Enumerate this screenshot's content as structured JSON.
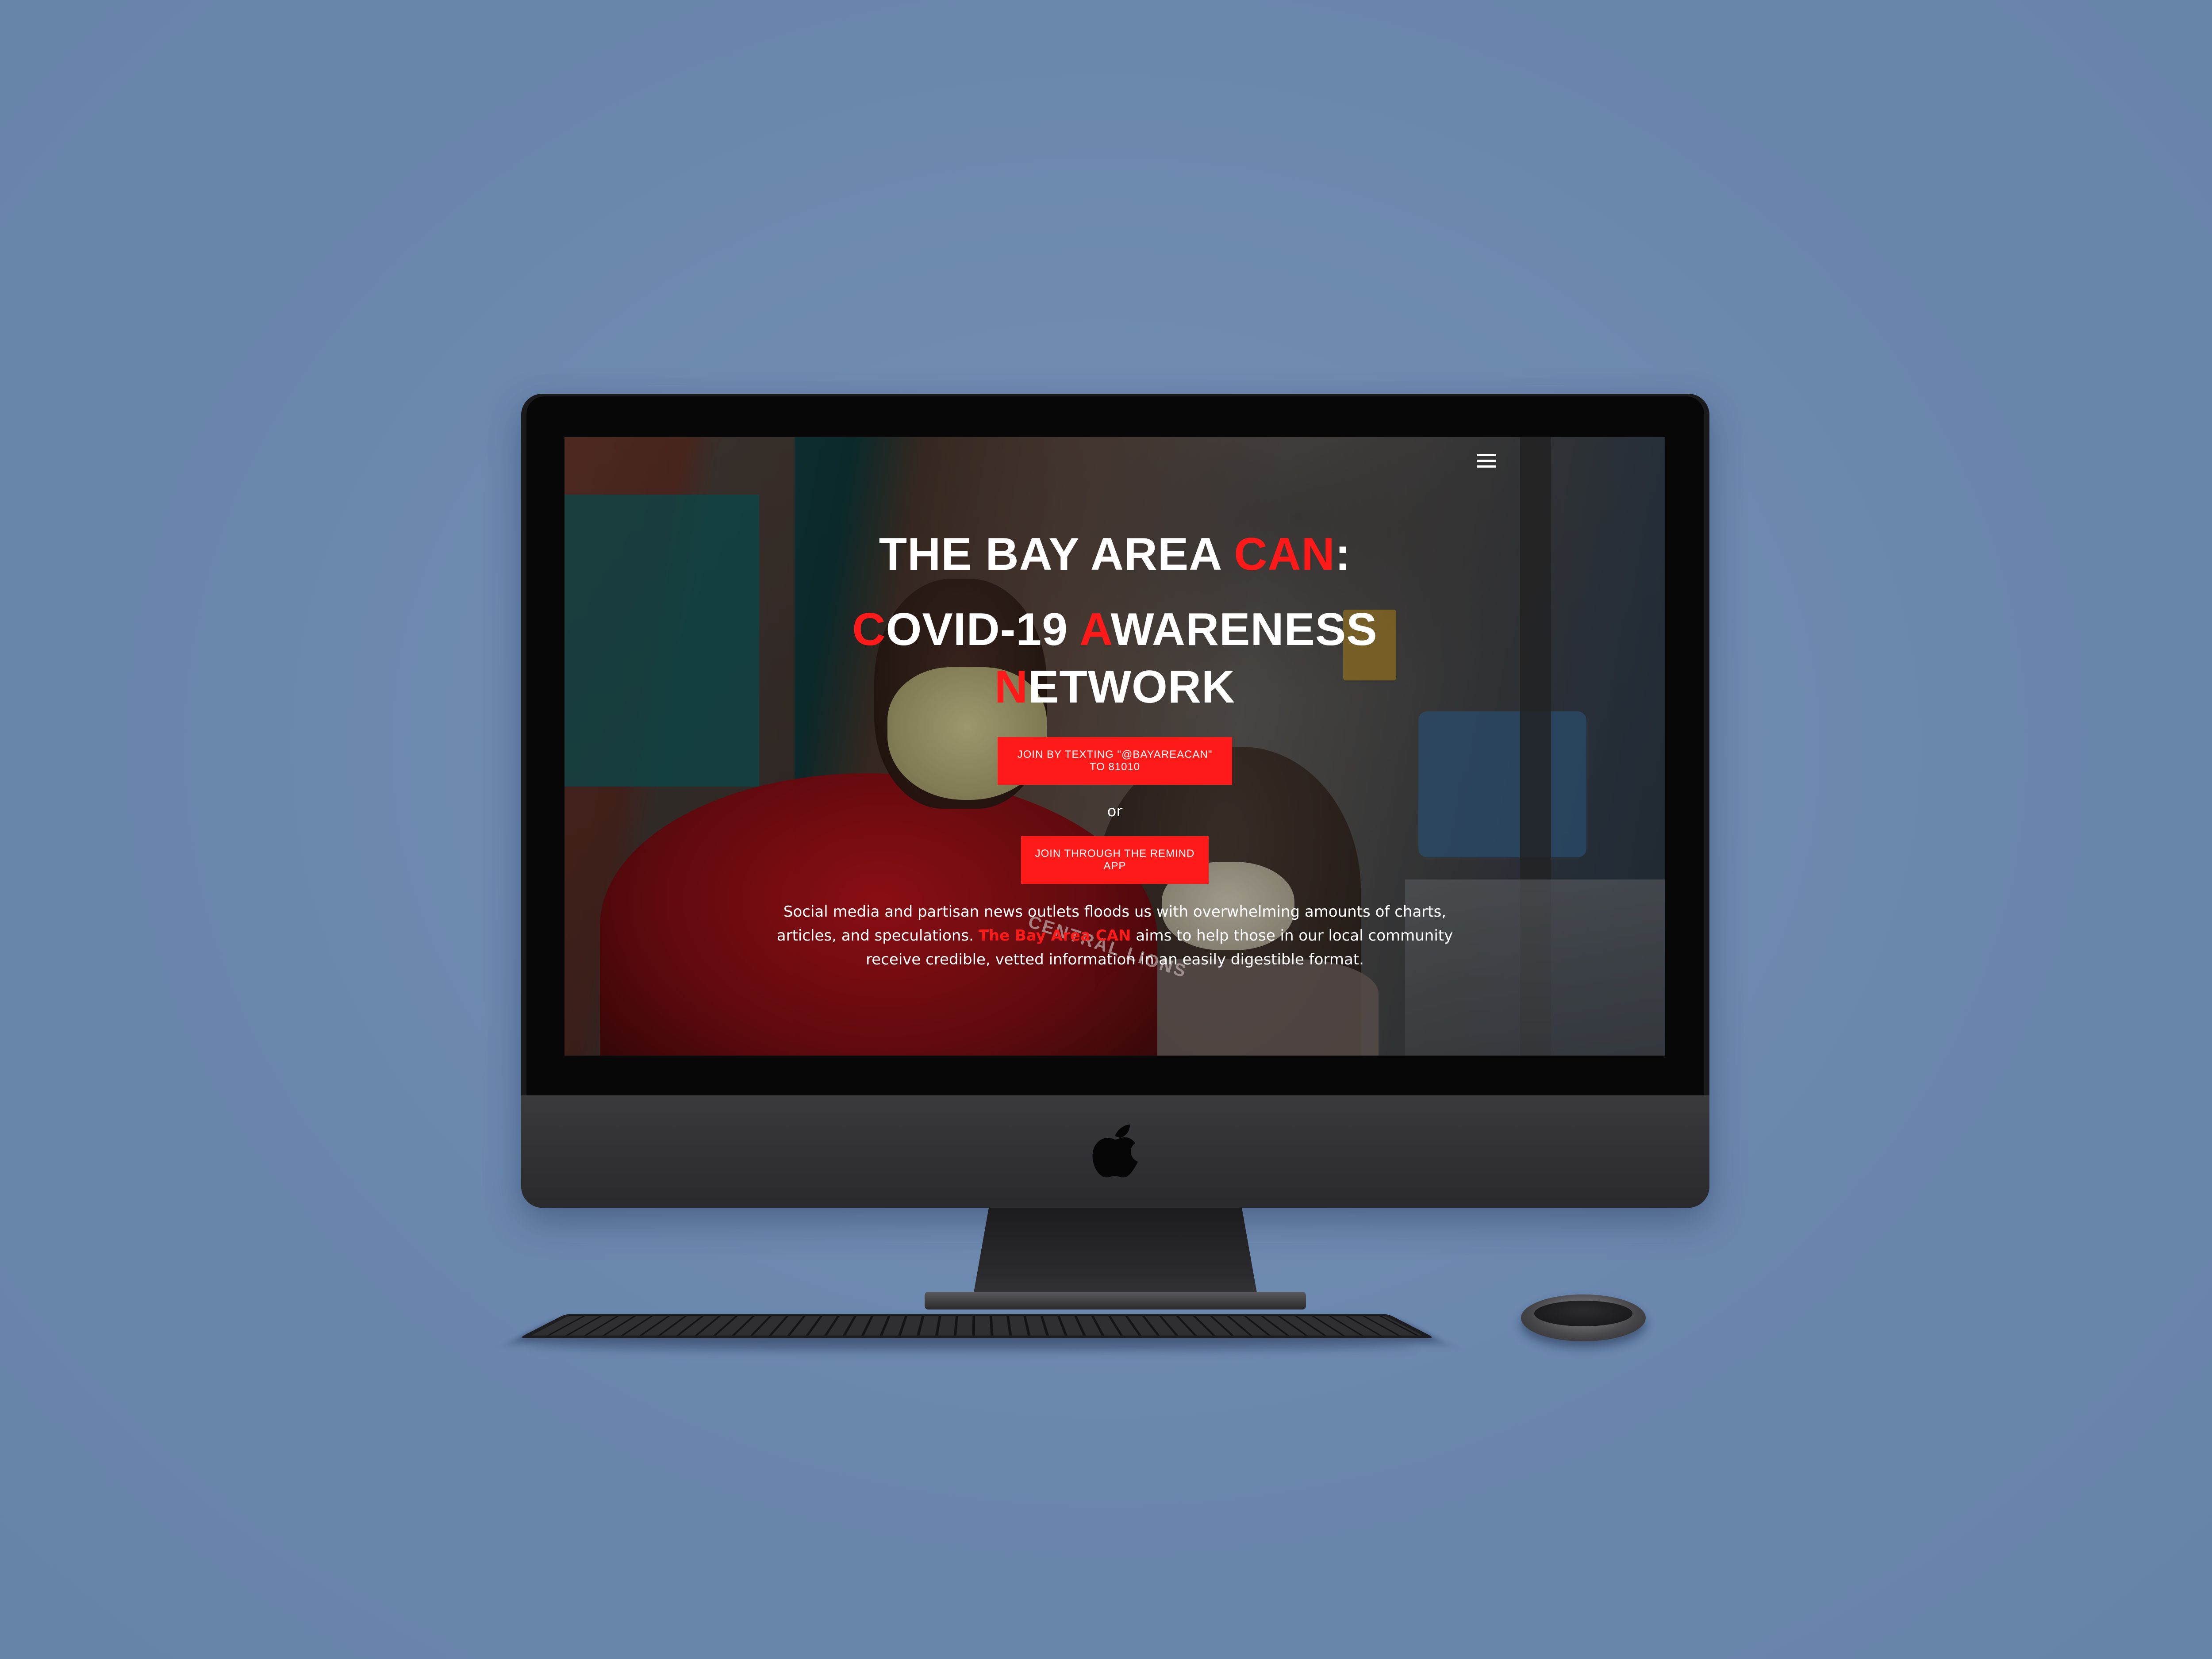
{
  "hero": {
    "title_line1_prefix": "THE BAY AREA ",
    "title_line1_highlight": "CAN",
    "title_line1_suffix": ":",
    "title_line2": {
      "c_letter": "C",
      "c_rest": "OVID-19 ",
      "a_letter": "A",
      "a_rest": "WARENESS ",
      "n_letter": "N",
      "n_rest": "ETWORK"
    },
    "cta_text_label": "JOIN BY TEXTING \"@BAYAREACAN\" TO 81010",
    "or_label": "or",
    "cta_app_label": "JOIN THROUGH THE REMIND APP",
    "blurb_part1": "Social media and partisan news outlets floods us with overwhelming amounts of charts, articles, and speculations. ",
    "blurb_brand": "The Bay Area CAN",
    "blurb_part2": " aims to help those in our local community receive credible, vetted information in an easily digestible format."
  },
  "photo": {
    "jacket_text": "CENTRAL LIONS"
  },
  "icons": {
    "menu": "hamburger-menu-icon",
    "apple": "apple-logo-icon"
  },
  "colors": {
    "accent_red": "#ff1a1a",
    "backdrop_blue": "#6a87ae",
    "imac_space_gray": "#1a1a1c"
  }
}
